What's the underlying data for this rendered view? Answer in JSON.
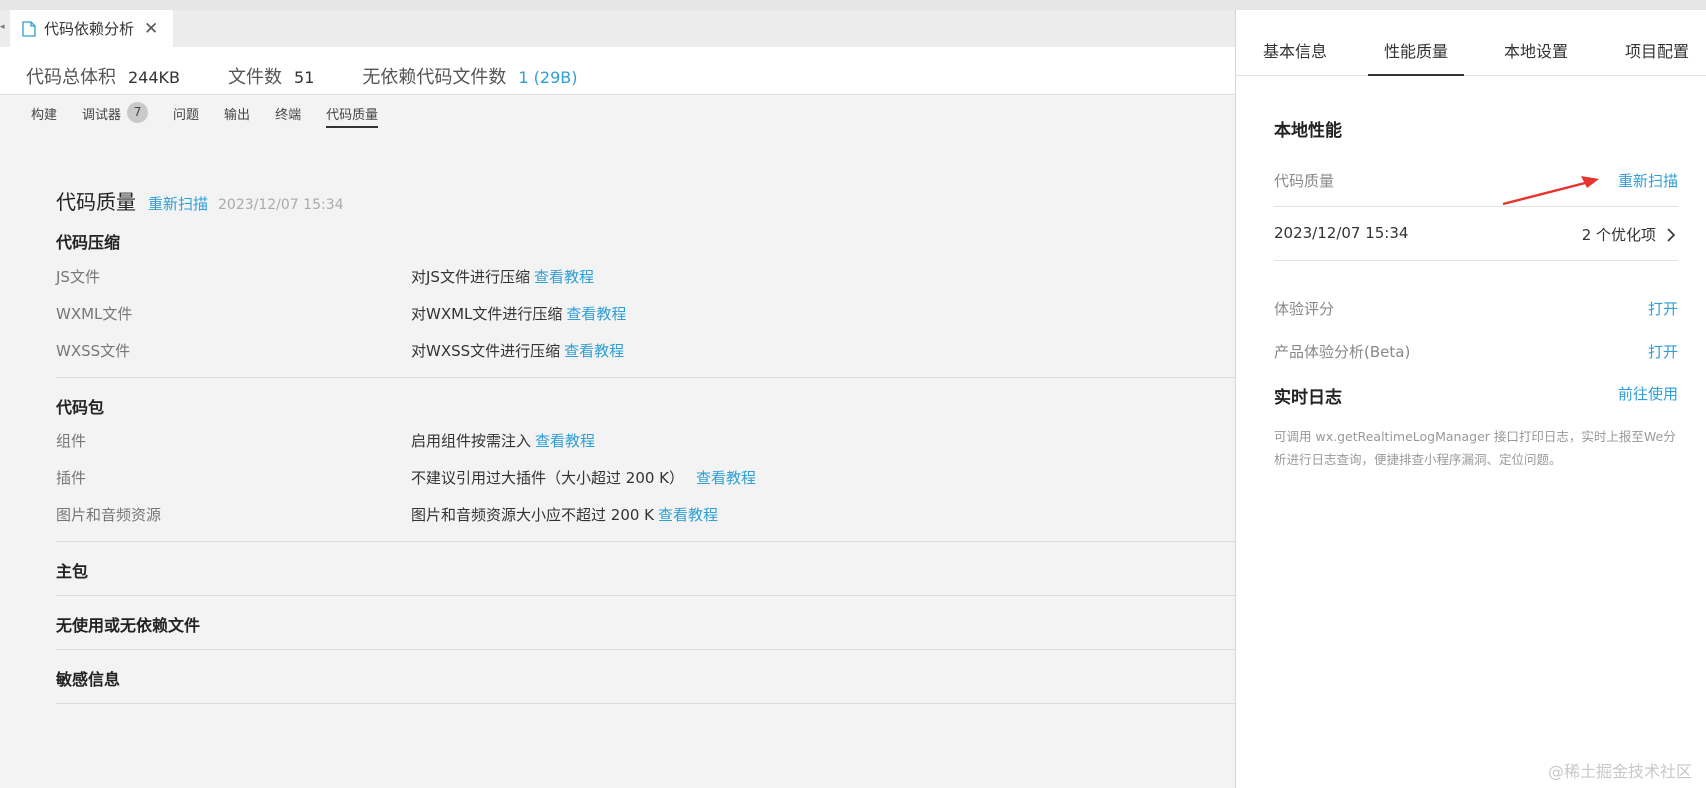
{
  "file_tab": {
    "title": "代码依赖分析",
    "close": "✕"
  },
  "summary": {
    "total_size_label": "代码总体积",
    "total_size_value": "244KB",
    "file_count_label": "文件数",
    "file_count_value": "51",
    "no_dep_label": "无依赖代码文件数",
    "no_dep_value": "1 (29B)"
  },
  "subtabs": [
    {
      "label": "构建"
    },
    {
      "label": "调试器",
      "badge": "7"
    },
    {
      "label": "问题"
    },
    {
      "label": "输出"
    },
    {
      "label": "终端"
    },
    {
      "label": "代码质量"
    }
  ],
  "quality": {
    "title": "代码质量",
    "rescan": "重新扫描",
    "time": "2023/12/07 15:34"
  },
  "sections": {
    "compress": {
      "title": "代码压缩",
      "rows": [
        {
          "name": "JS文件",
          "desc": "对JS文件进行压缩",
          "link": "查看教程"
        },
        {
          "name": "WXML文件",
          "desc": "对WXML文件进行压缩",
          "link": "查看教程"
        },
        {
          "name": "WXSS文件",
          "desc": "对WXSS文件进行压缩",
          "link": "查看教程"
        }
      ]
    },
    "package": {
      "title": "代码包",
      "rows": [
        {
          "name": "组件",
          "desc": "启用组件按需注入",
          "link": "查看教程"
        },
        {
          "name": "插件",
          "desc": "不建议引用过大插件（大小超过 200 K）",
          "link": "查看教程"
        },
        {
          "name": "图片和音频资源",
          "desc": "图片和音频资源大小应不超过 200 K",
          "link": "查看教程"
        }
      ]
    },
    "main_pkg": {
      "title": "主包"
    },
    "unused": {
      "title": "无使用或无依赖文件"
    },
    "sensitive": {
      "title": "敏感信息"
    }
  },
  "right_tabs": [
    "基本信息",
    "性能质量",
    "本地设置",
    "项目配置"
  ],
  "right_panel": {
    "local_perf": "本地性能",
    "code_quality_label": "代码质量",
    "code_quality_action": "重新扫描",
    "scan_time": "2023/12/07 15:34",
    "scan_result": "2 个优化项",
    "experience_label": "体验评分",
    "experience_action": "打开",
    "product_label": "产品体验分析(Beta)",
    "product_action": "打开",
    "realtime_log": "实时日志",
    "realtime_action": "前往使用",
    "note": "可调用 wx.getRealtimeLogManager 接口打印日志，实时上报至We分析进行日志查询，便捷排查小程序漏洞、定位问题。"
  },
  "watermark": "@稀土掘金技术社区",
  "colors": {
    "link": "#2e9fd7",
    "arrow": "#e8322c"
  }
}
